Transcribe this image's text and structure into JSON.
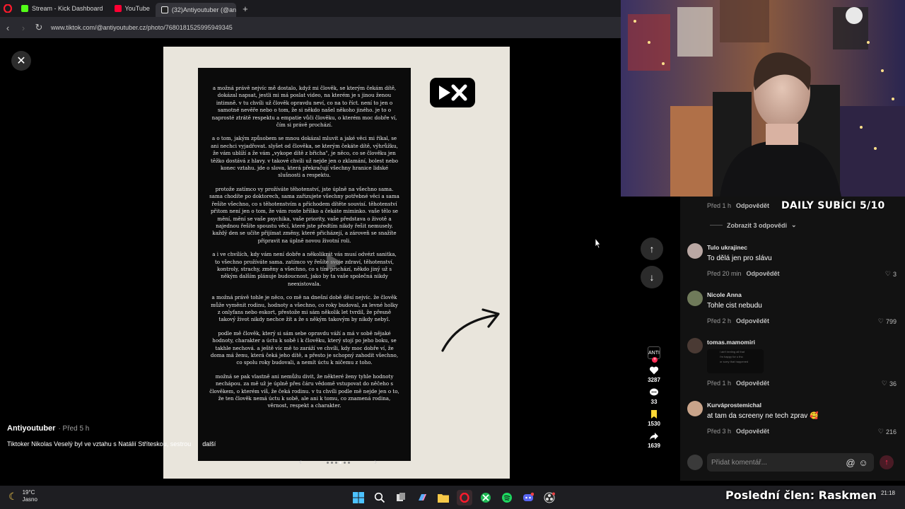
{
  "tabs": [
    {
      "label": "Stream - Kick Dashboard",
      "favicon_color": "#53fc18"
    },
    {
      "label": "YouTube",
      "favicon_color": "#ff0033"
    },
    {
      "label": "(32)Antiyoutuber (@antiy",
      "favicon_color": "#ffffff"
    }
  ],
  "browser": {
    "url": "www.tiktok.com/@antiyoutuber.cz/photo/7680181525995949345"
  },
  "post": {
    "author": "Antiyoutuber",
    "posted": "· Před 5 h",
    "description": "Tiktoker Nikolas Veselý byl ve vztahu s Natálií Stříteskou, sestrou",
    "more": "další",
    "note_paragraphs": [
      "a možná právě nejvíc mě dostalo, když mi člověk, se kterým čekám dítě, dokázal napsat, jestli mi má poslat video, na kterém je s jinou ženou intimně. v tu chvíli už člověk opravdu neví, co na to říct. není to jen o samotné nevěře nebo o tom, že si někdo našel někoho jiného. je to o naprosté ztrátě respektu a empatie vůči člověku, o kterém moc dobře ví, čím si právě prochází.",
      "a o tom, jakým způsobem se mnou dokázal mluvit a jaké věci mi říkal, se ani nechci vyjadřovat. slyšet od člověka, se kterým čekáte dítě, výhrůžku, že vám ublíží a že vám „vykope dítě z břicha\", je něco, co se člověku jen těžko dostává z hlavy. v takové chvíli už nejde jen o zklamání, bolest nebo konec vztahu. jde o slova, která překračují všechny hranice lidské slušnosti a respektu.",
      "protože zatímco vy prožíváte těhotenství, jste úplně na všechno sama. sama chodíte po doktorech, sama zařizujete všechny potřebné věci a sama řešíte všechno, co s těhotenstvím a příchodem dítěte souvisí. těhotenství přitom není jen o tom, že vám roste bříško a čekáte miminko. vaše tělo se mění, mění se vaše psychika, vaše priority, vaše představa o životě a najednou řešíte spoustu věcí, které jste předtím nikdy řešit nemusely. každý den se učíte přijímat změny, které přicházejí, a zároveň se snažíte připravit na úplně novou životní roli.",
      "a i ve chvílích, kdy vám není dobře a několikrát vás musí odvézt sanitka, to všechno prožíváte sama. zatímco vy řešíte svoje zdraví, těhotenství, kontroly, strachy, změny a všechno, co s tím přichází, někdo jiný už s někým dalším plánuje budoucnost, jako by ta vaše společná nikdy neexistovala.",
      "a možná právě tohle je něco, co mě na dnešní době děsí nejvíc. že člověk může vyměnit rodinu, hodnoty a všechno, co roky budoval, za levné holky z onlyfans nebo eskort, přestože mi sám několik let tvrdil, že přesně takový život nikdy nechce žít a že s někým takovým by nikdy nebyl.",
      "podle mě člověk, který si sám sebe opravdu váží a má v sobě nějaké hodnoty, charakter a úctu k sobě i k člověku, který stojí po jeho boku, se takhle nechová. a ještě víc mě to zaráží ve chvíli, kdy moc dobře ví, že doma má ženu, která čeká jeho dítě, a přesto je schopný zahodit všechno, co spolu roky budovali, a nemít úctu k ničemu z toho.",
      "možná se pak vlastně ani nemůžu divit, že některé ženy tyhle hodnoty nechápou. za mě už je úplně přes čáru vědomě vstupovat do něčeho s člověkem, o kterém víš, že čeká rodinu. v tu chvíli podle mě nejde jen o to, že ten člověk nemá úctu k sobě, ale ani k tomu, co znamená rodina, věrnost, respekt a charakter."
    ],
    "photo_index": 4,
    "photo_count": 6
  },
  "actions": {
    "likes": "3287",
    "comments": "33",
    "saves": "1530",
    "shares": "1639",
    "mini_avatar_label": "ANTI"
  },
  "comments": {
    "top_meta": {
      "time": "Před 1 h",
      "reply": "Odpovědět"
    },
    "expand_label": "Zobrazit 3 odpovědi",
    "items": [
      {
        "user": "Tulo ukrajinec",
        "text": "To dělá jen pro slávu",
        "time": "Před 20 min",
        "reply": "Odpovědět",
        "likes": "3",
        "avatar_color": "#b9a7a3"
      },
      {
        "user": "Nicole Anna",
        "text": "Tohle cist nebudu",
        "time": "Před 2 h",
        "reply": "Odpovědět",
        "likes": "799",
        "avatar_color": "#6f7a5a"
      },
      {
        "user": "tomas.mamomiri",
        "text": "",
        "time": "Před 1 h",
        "reply": "Odpovědět",
        "likes": "36",
        "avatar_color": "#4a3a34"
      },
      {
        "user": "Kurváprostemichal",
        "text": "at tam da screeny ne tech zprav 🥰",
        "time": "Před 3 h",
        "reply": "Odpovědět",
        "likes": "216",
        "avatar_color": "#c9a48a"
      }
    ],
    "thumb_lines": [
      "i ain't texting all that",
      "i'm happy for u tho",
      "or sorry that happened"
    ],
    "input_placeholder": "Přidat komentář..."
  },
  "overlay": {
    "daily": "DAILY SUBÍCI 5/10",
    "last_member": "Poslední člen: Raskmen"
  },
  "taskbar": {
    "temp": "19°C",
    "condition": "Jasno",
    "time": "21:18"
  }
}
